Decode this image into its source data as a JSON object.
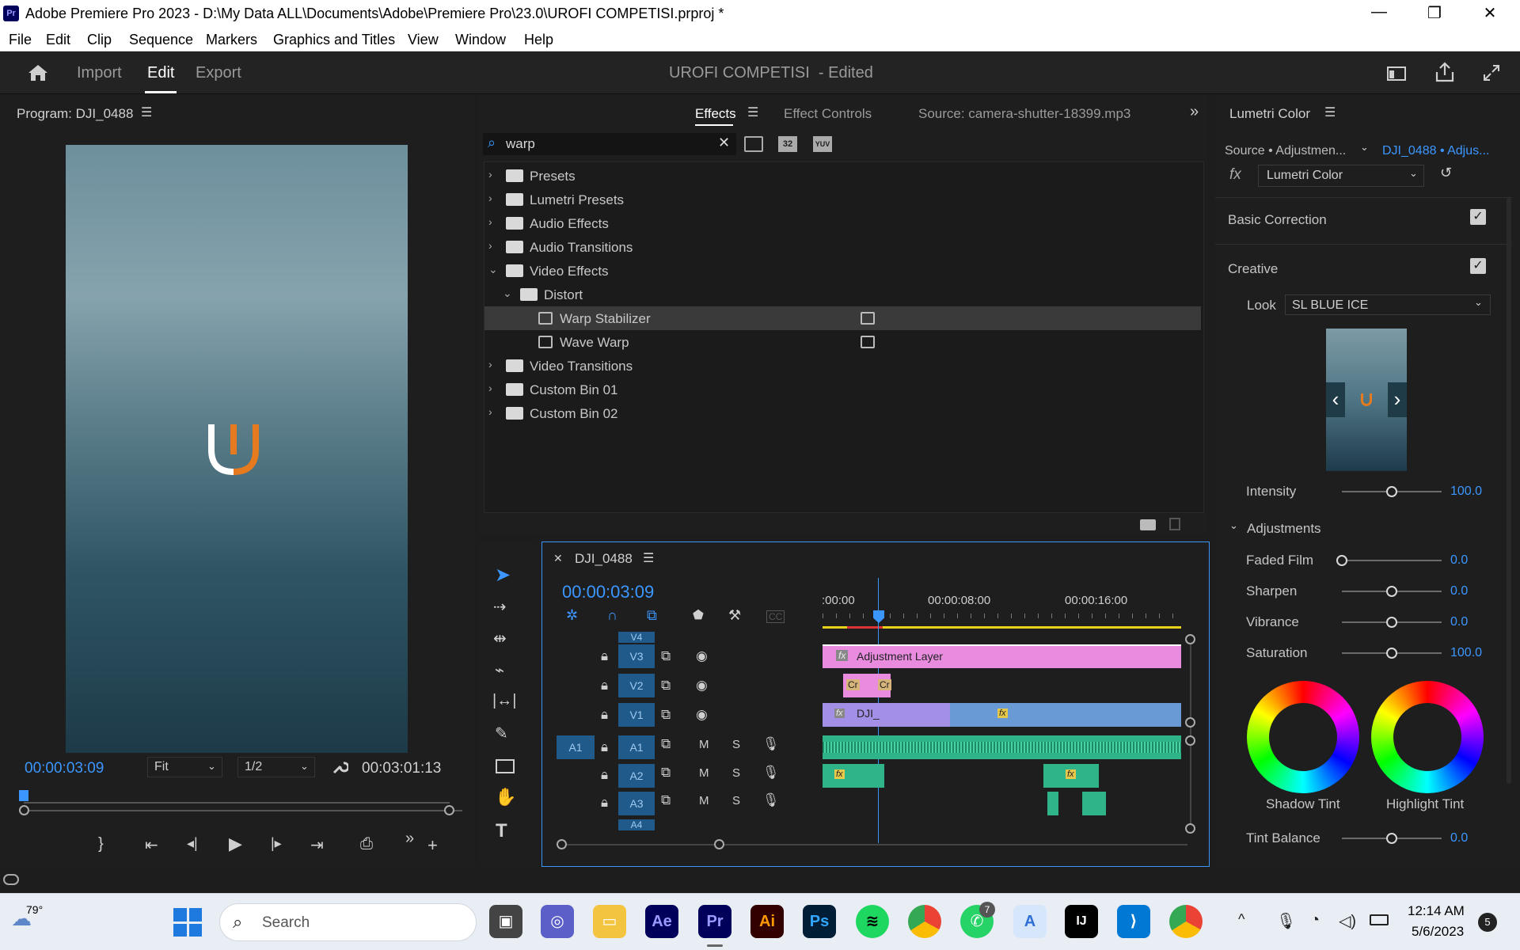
{
  "window": {
    "title": "Adobe Premiere Pro 2023 - D:\\My Data ALL\\Documents\\Adobe\\Premiere Pro\\23.0\\UROFI COMPETISI.prproj *",
    "app_badge": "Pr",
    "minimize": "—",
    "maximize": "❐",
    "close": "✕"
  },
  "menubar": {
    "items": [
      "File",
      "Edit",
      "Clip",
      "Sequence",
      "Markers",
      "Graphics and Titles",
      "View",
      "Window",
      "Help"
    ]
  },
  "header": {
    "tabs": [
      "Import",
      "Edit",
      "Export"
    ],
    "active_tab": "Edit",
    "project_name": "UROFI COMPETISI",
    "status": "- Edited"
  },
  "program_monitor": {
    "title": "Program: DJI_0488",
    "current_time": "00:00:03:09",
    "fit": "Fit",
    "resolution": "1/2",
    "duration": "00:03:01:13"
  },
  "effects_panel": {
    "tabs": [
      "Effects",
      "Effect Controls",
      "Source: camera-shutter-18399.mp3"
    ],
    "active_tab": "Effects",
    "search_value": "warp",
    "filter_badges": [
      "32",
      "YUV"
    ],
    "tree": [
      {
        "label": "Presets",
        "indent": 0,
        "type": "folder-star",
        "expanded": false
      },
      {
        "label": "Lumetri Presets",
        "indent": 0,
        "type": "folder-star",
        "expanded": false
      },
      {
        "label": "Audio Effects",
        "indent": 0,
        "type": "folder",
        "expanded": false
      },
      {
        "label": "Audio Transitions",
        "indent": 0,
        "type": "folder",
        "expanded": false
      },
      {
        "label": "Video Effects",
        "indent": 0,
        "type": "folder",
        "expanded": true
      },
      {
        "label": "Distort",
        "indent": 1,
        "type": "folder",
        "expanded": true
      },
      {
        "label": "Warp Stabilizer",
        "indent": 2,
        "type": "effect",
        "selected": true
      },
      {
        "label": "Wave Warp",
        "indent": 2,
        "type": "effect"
      },
      {
        "label": "Video Transitions",
        "indent": 0,
        "type": "folder",
        "expanded": false
      },
      {
        "label": "Custom Bin 01",
        "indent": 0,
        "type": "folder",
        "expanded": false
      },
      {
        "label": "Custom Bin 02",
        "indent": 0,
        "type": "folder",
        "expanded": false
      }
    ]
  },
  "timeline": {
    "sequence_name": "DJI_0488",
    "timecode": "00:00:03:09",
    "ruler": [
      ":00:00",
      "00:00:08:00",
      "00:00:16:00"
    ],
    "video_tracks": [
      "V4",
      "V3",
      "V2",
      "V1"
    ],
    "audio_tracks": [
      "A1",
      "A2",
      "A3",
      "A4"
    ],
    "source_patch": "A1",
    "track_m": "M",
    "track_s": "S",
    "clips": {
      "adjustment": "Adjustment Layer",
      "v1_clip": "DJI_",
      "fx": "fx",
      "cr": "Cr"
    }
  },
  "lumetri": {
    "title": "Lumetri Color",
    "source_label": "Source • Adjustmen...",
    "target_label": "DJI_0488 • Adjus...",
    "effect_name": "Lumetri Color",
    "fx_label": "fx",
    "sections": {
      "basic": "Basic Correction",
      "creative": "Creative",
      "adjustments": "Adjustments"
    },
    "look_label": "Look",
    "look_value": "SL BLUE ICE",
    "intensity": {
      "label": "Intensity",
      "value": "100.0",
      "level": 0.5
    },
    "sliders": [
      {
        "label": "Faded Film",
        "value": "0.0",
        "level": 0.0
      },
      {
        "label": "Sharpen",
        "value": "0.0",
        "level": 0.5
      },
      {
        "label": "Vibrance",
        "value": "0.0",
        "level": 0.5
      },
      {
        "label": "Saturation",
        "value": "100.0",
        "level": 0.5
      }
    ],
    "wheels": [
      "Shadow Tint",
      "Highlight Tint"
    ],
    "tint_balance": {
      "label": "Tint Balance",
      "value": "0.0",
      "level": 0.5
    }
  },
  "taskbar": {
    "weather_temp": "79°",
    "search_placeholder": "Search",
    "time": "12:14 AM",
    "date": "5/6/2023",
    "notifications": "5",
    "whatsapp_badge": "7",
    "apps": [
      {
        "name": "Ae",
        "color": "#00005b",
        "fg": "#9999ff"
      },
      {
        "name": "Pr",
        "color": "#00005b",
        "fg": "#9999ff"
      },
      {
        "name": "Ai",
        "color": "#330000",
        "fg": "#ff9a00"
      },
      {
        "name": "Ps",
        "color": "#001e36",
        "fg": "#31a8ff"
      }
    ]
  }
}
